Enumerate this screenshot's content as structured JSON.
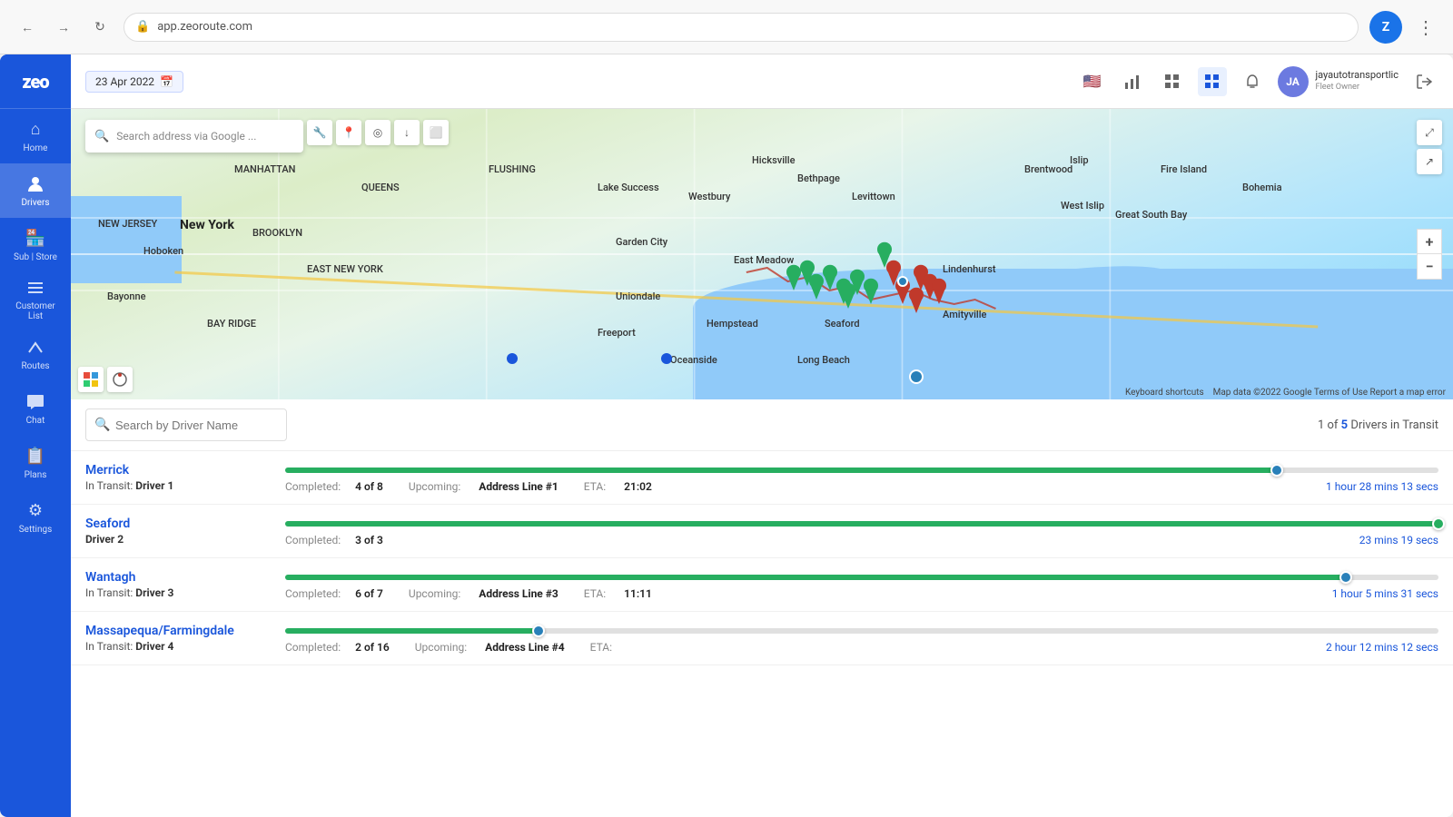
{
  "browser": {
    "address": "app.zeoroute.com",
    "profile_initial": "Z",
    "menu_label": "⋮"
  },
  "topbar": {
    "date": "23 Apr 2022",
    "user_name": "jayautotransportlic",
    "user_role": "Fleet Owner",
    "icons": [
      "flag",
      "chart-bar",
      "grid",
      "map-active",
      "bell"
    ]
  },
  "sidebar": {
    "logo": "zeo",
    "items": [
      {
        "id": "home",
        "label": "Home",
        "icon": "⌂",
        "active": false
      },
      {
        "id": "drivers",
        "label": "Drivers",
        "icon": "👤",
        "active": true
      },
      {
        "id": "sub-store",
        "label": "Sub | Store",
        "icon": "🏪",
        "active": false
      },
      {
        "id": "customer-list",
        "label": "Customer List",
        "icon": "☰",
        "active": false
      },
      {
        "id": "routes",
        "label": "Routes",
        "icon": "↗",
        "active": false
      },
      {
        "id": "chat",
        "label": "Chat",
        "icon": "💬",
        "active": false
      },
      {
        "id": "plans",
        "label": "Plans",
        "icon": "📋",
        "active": false
      },
      {
        "id": "settings",
        "label": "Settings",
        "icon": "⚙",
        "active": false
      }
    ]
  },
  "map": {
    "search_placeholder": "Search address via Google ...",
    "attribution": "Map data ©2022 Google  Terms of Use  Report a map error",
    "keyboard_shortcuts": "Keyboard shortcuts",
    "zoom_in": "+",
    "zoom_out": "−"
  },
  "drivers_panel": {
    "search_placeholder": "Search by Driver Name",
    "count_text": "1 of 5 Drivers in Transit",
    "drivers": [
      {
        "id": "merrick",
        "name": "Merrick",
        "status": "In Transit:",
        "driver_label": "Driver 1",
        "progress_pct": 86,
        "dot_color": "blue",
        "completed": "4 of 8",
        "upcoming_label": "Address Line #1",
        "eta_time": "21:02",
        "eta_remaining": "1 hour 28 mins 13 secs"
      },
      {
        "id": "seaford",
        "name": "Seaford",
        "status": "",
        "driver_label": "Driver 2",
        "progress_pct": 100,
        "dot_color": "green",
        "completed": "3 of 3",
        "upcoming_label": "",
        "eta_time": "",
        "eta_remaining": "23 mins 19 secs"
      },
      {
        "id": "wantagh",
        "name": "Wantagh",
        "status": "In Transit:",
        "driver_label": "Driver 3",
        "progress_pct": 92,
        "dot_color": "blue",
        "completed": "6 of 7",
        "upcoming_label": "Address Line #3",
        "eta_time": "11:11",
        "eta_remaining": "1 hour 5 mins 31 secs"
      },
      {
        "id": "massapequa",
        "name": "Massapequa/Farmingdale",
        "status": "In Transit:",
        "driver_label": "Driver 4",
        "progress_pct": 22,
        "dot_color": "blue",
        "completed": "2 of 16",
        "upcoming_label": "Address Line #4",
        "eta_time": "",
        "eta_remaining": "2 hour 12 mins 12 secs"
      }
    ]
  }
}
